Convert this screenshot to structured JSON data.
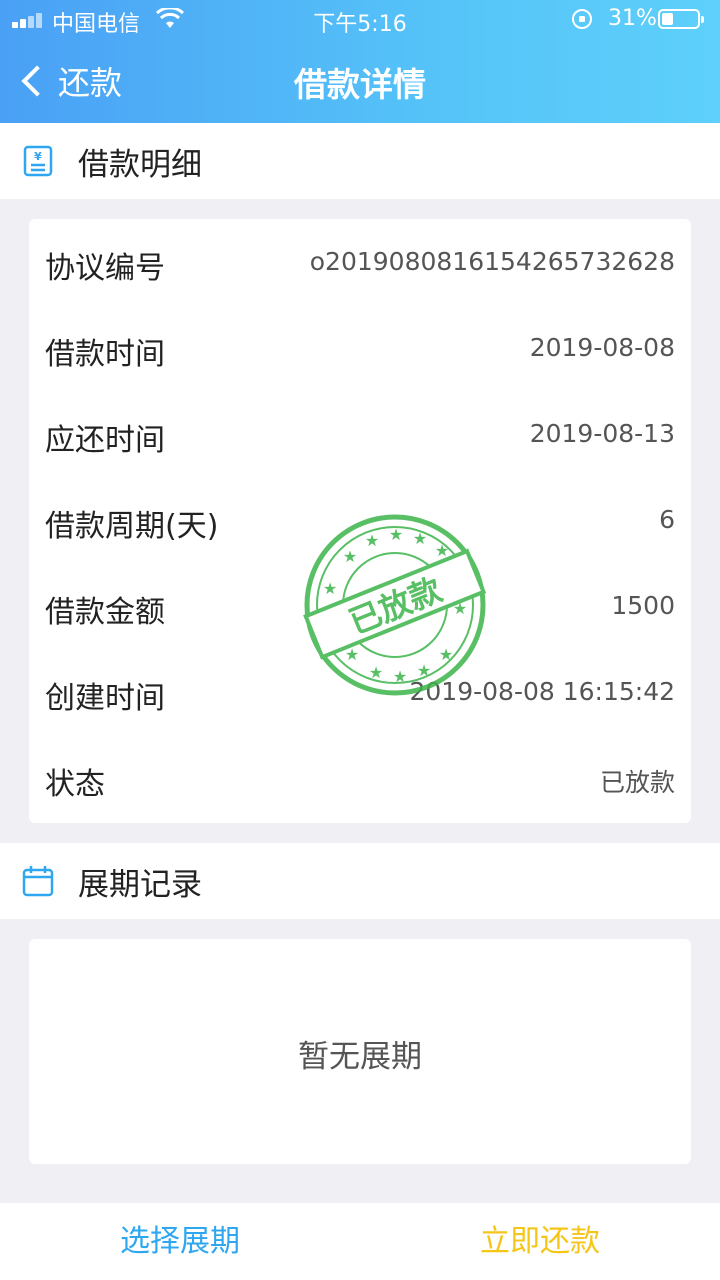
{
  "status_bar": {
    "carrier": "中国电信",
    "time": "下午5:16",
    "battery": "31%"
  },
  "nav": {
    "back_label": "还款",
    "title": "借款详情"
  },
  "loan_section": {
    "title": "借款明细",
    "rows": [
      {
        "label": "协议编号",
        "value": "o2019080816154265732628"
      },
      {
        "label": "借款时间",
        "value": "2019-08-08"
      },
      {
        "label": "应还时间",
        "value": "2019-08-13"
      },
      {
        "label": "借款周期(天)",
        "value": "6"
      },
      {
        "label": "借款金额",
        "value": "1500"
      },
      {
        "label": "创建时间",
        "value": "2019-08-08 16:15:42"
      },
      {
        "label": "状态",
        "value": "已放款"
      }
    ],
    "stamp_text": "已放款"
  },
  "extension_section": {
    "title": "展期记录",
    "empty_text": "暂无展期"
  },
  "bottom": {
    "select_extension": "选择展期",
    "repay_now": "立即还款"
  },
  "colors": {
    "header_gradient_start": "#4aa0f5",
    "header_gradient_end": "#5ed0fb",
    "accent_blue": "#2ea7f0",
    "accent_yellow": "#f5c518",
    "stamp_green": "#3cb44b"
  }
}
